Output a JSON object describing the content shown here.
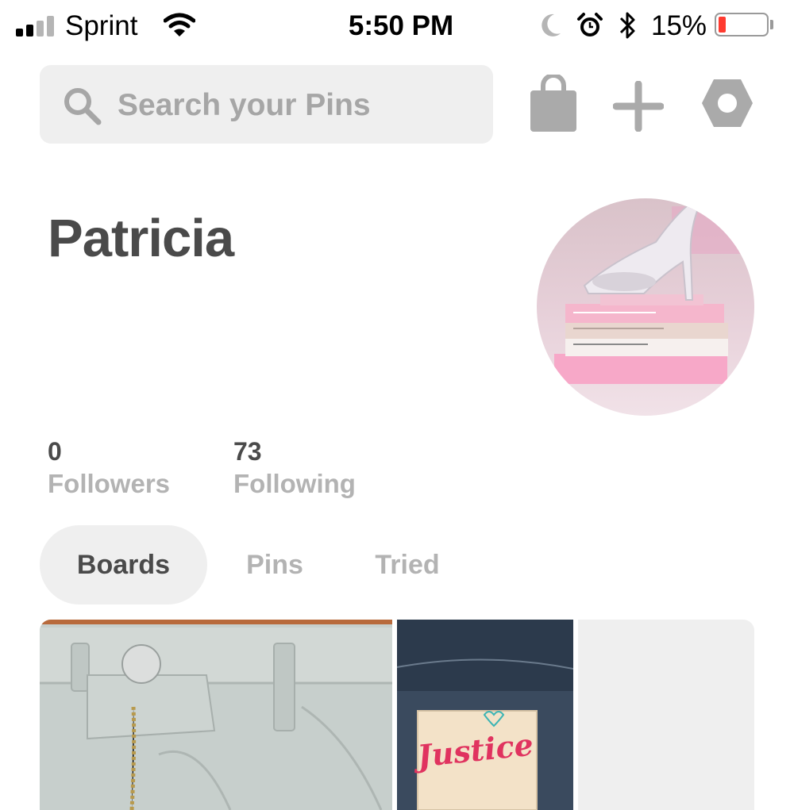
{
  "status_bar": {
    "carrier": "Sprint",
    "time": "5:50 PM",
    "battery_percent": "15%",
    "battery_level": 0.15,
    "battery_color": "#ff3b30",
    "icons": [
      "signal-icon",
      "wifi-icon",
      "moon-icon",
      "alarm-icon",
      "bluetooth-icon",
      "battery-icon"
    ]
  },
  "search": {
    "placeholder": "Search your Pins",
    "value": ""
  },
  "header_actions": {
    "icons": [
      "shopping-bag-icon",
      "plus-icon",
      "settings-icon"
    ],
    "icon_color": "#aaaaaa"
  },
  "profile": {
    "name": "Patricia",
    "followers_count": "0",
    "followers_label": "Followers",
    "following_count": "73",
    "following_label": "Following"
  },
  "tabs": [
    {
      "label": "Boards",
      "selected": true
    },
    {
      "label": "Pins",
      "selected": false
    },
    {
      "label": "Tried",
      "selected": false
    }
  ],
  "board_tile_text": {
    "tag_brand": "Justice"
  },
  "colors": {
    "text_dark": "#4a4a4a",
    "text_muted": "#b3b3b3",
    "surface": "#efefef"
  }
}
